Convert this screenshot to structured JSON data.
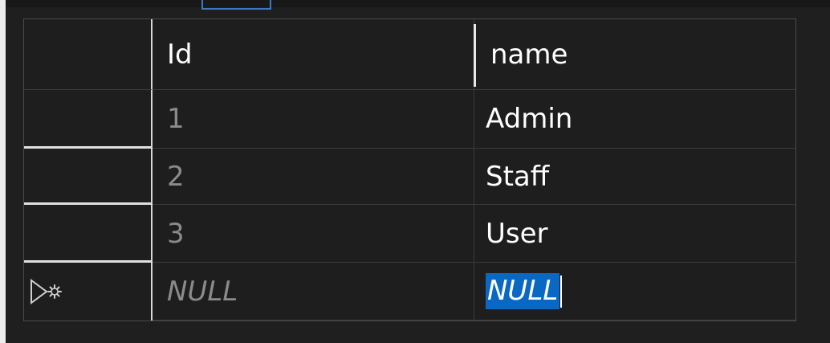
{
  "columns": [
    {
      "label": ""
    },
    {
      "label": "Id"
    },
    {
      "label": "name"
    }
  ],
  "rows": [
    {
      "id": "1",
      "name": "Admin"
    },
    {
      "id": "2",
      "name": "Staff"
    },
    {
      "id": "3",
      "name": "User"
    }
  ],
  "new_row": {
    "id": "NULL",
    "name": "NULL",
    "icon": "new-row-pencil-asterisk-icon"
  },
  "colors": {
    "background": "#1e1e1e",
    "selection": "#0a68c5",
    "grid_line": "#3a3a3a",
    "muted_text": "#8b8b8b",
    "text": "#ffffff"
  }
}
